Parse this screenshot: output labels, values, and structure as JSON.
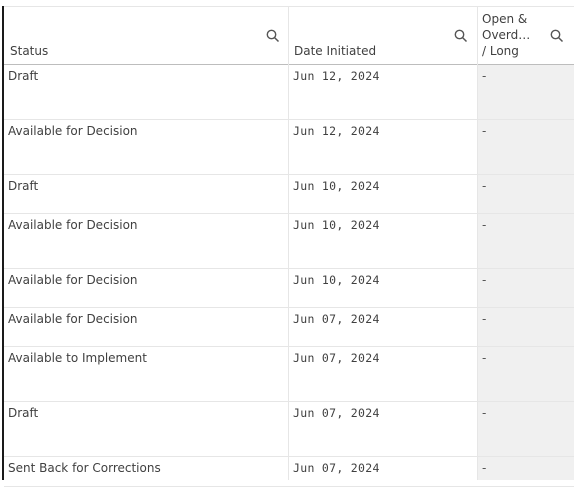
{
  "table": {
    "columns": [
      {
        "label": "Status",
        "icon": "search-icon"
      },
      {
        "label": "Date Initiated",
        "icon": "search-icon"
      },
      {
        "label": "Open &\nOverd…\n/ Long",
        "icon": "search-icon"
      }
    ],
    "rows": [
      {
        "status": "Draft",
        "date": "Jun 12, 2024",
        "open": "-"
      },
      {
        "status": "Available for Decision",
        "date": "Jun 12, 2024",
        "open": "-"
      },
      {
        "status": "Draft",
        "date": "Jun 10, 2024",
        "open": "-"
      },
      {
        "status": "Available for Decision",
        "date": "Jun 10, 2024",
        "open": "-"
      },
      {
        "status": "Available for Decision",
        "date": "Jun 10, 2024",
        "open": "-"
      },
      {
        "status": "Available for Decision",
        "date": "Jun 07, 2024",
        "open": "-"
      },
      {
        "status": "Available to Implement",
        "date": "Jun 07, 2024",
        "open": "-"
      },
      {
        "status": "Draft",
        "date": "Jun 07, 2024",
        "open": "-"
      },
      {
        "status": "Sent Back for Corrections",
        "date": "Jun 07, 2024",
        "open": "-"
      }
    ]
  },
  "colors": {
    "accent_bar": "#1a1a1a",
    "last_column_bg": "#f0f0f0",
    "grid": "#e6e6e6"
  }
}
